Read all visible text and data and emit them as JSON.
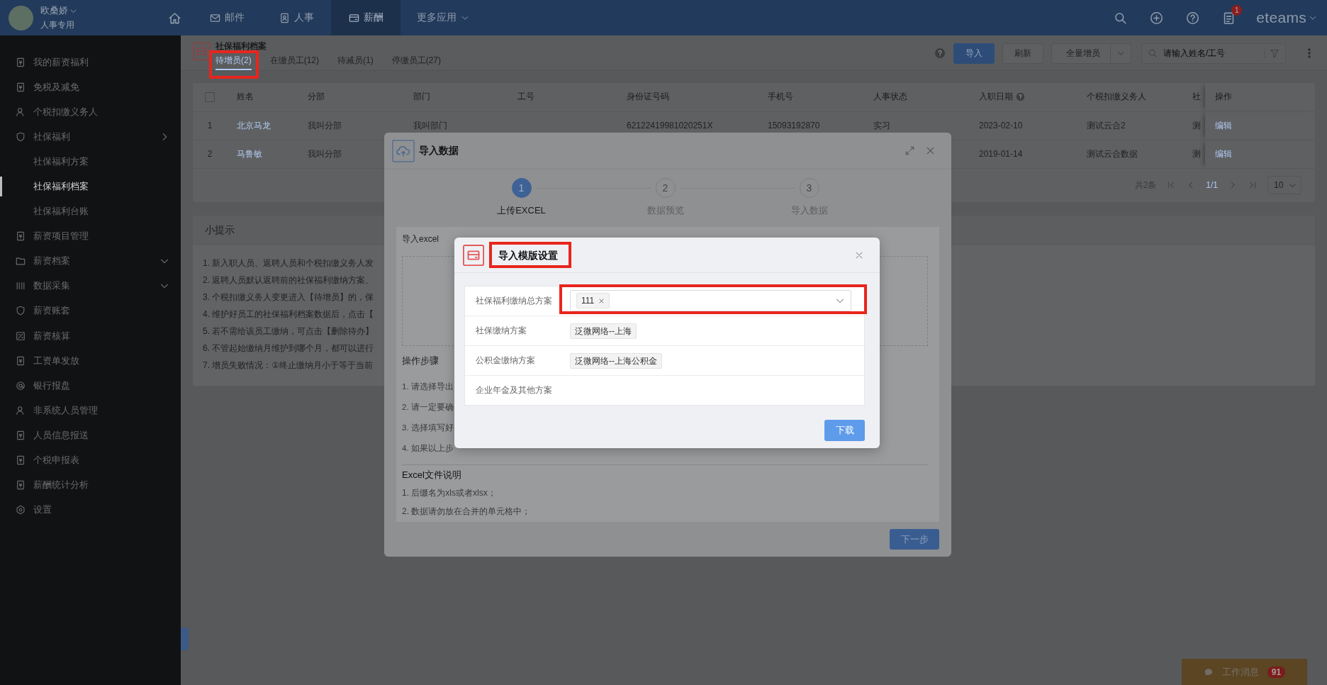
{
  "header": {
    "user": {
      "name": "欧桑娇",
      "role": "人事专用"
    },
    "nav": [
      {
        "label": "邮件",
        "kind": "link",
        "selected": false
      },
      {
        "label": "人事",
        "kind": "link",
        "selected": false
      },
      {
        "label": "薪酬",
        "kind": "link",
        "selected": true
      },
      {
        "label": "更多应用",
        "kind": "menu",
        "selected": false
      }
    ],
    "notification_count": "1",
    "logo": "eteams"
  },
  "sidebar": {
    "items": [
      {
        "label": "我的薪资福利",
        "selected": false
      },
      {
        "label": "免税及减免",
        "selected": false
      },
      {
        "label": "个税扣缴义务人",
        "selected": false
      },
      {
        "label": "社保福利",
        "selected": false,
        "expanded": true,
        "children": [
          {
            "label": "社保福利方案",
            "selected": false
          },
          {
            "label": "社保福利档案",
            "selected": true
          },
          {
            "label": "社保福利台账",
            "selected": false
          }
        ]
      },
      {
        "label": "薪资项目管理",
        "selected": false
      },
      {
        "label": "薪资档案",
        "selected": false,
        "expanded": false
      },
      {
        "label": "数据采集",
        "selected": false,
        "expanded": false
      },
      {
        "label": "薪资账套",
        "selected": false
      },
      {
        "label": "薪资核算",
        "selected": false
      },
      {
        "label": "工资单发放",
        "selected": false
      },
      {
        "label": "银行报盘",
        "selected": false
      },
      {
        "label": "非系统人员管理",
        "selected": false
      },
      {
        "label": "人员信息报送",
        "selected": false
      },
      {
        "label": "个税申报表",
        "selected": false
      },
      {
        "label": "薪酬统计分析",
        "selected": false
      },
      {
        "label": "设置",
        "selected": false
      }
    ]
  },
  "page": {
    "title": "社保福利档案",
    "tabs": [
      {
        "label": "待增员(2)",
        "selected": true,
        "highlighted": true
      },
      {
        "label": "在缴员工(12)",
        "selected": false,
        "highlighted": false
      },
      {
        "label": "待减员(1)",
        "selected": false,
        "highlighted": false
      },
      {
        "label": "停缴员工(27)",
        "selected": false,
        "highlighted": false
      }
    ],
    "toolbar": {
      "buttons": [
        {
          "label": "导入",
          "kind": "primary"
        },
        {
          "label": "刷新",
          "kind": "default"
        },
        {
          "label": "全量增员",
          "kind": "split"
        }
      ],
      "search": {
        "placeholder": "请输入姓名/工号"
      }
    },
    "table": {
      "select_all_checked": false,
      "columns": [
        {
          "label": "姓名",
          "help": false
        },
        {
          "label": "分部",
          "help": false
        },
        {
          "label": "部门",
          "help": false
        },
        {
          "label": "工号",
          "help": false
        },
        {
          "label": "身份证号码",
          "help": false
        },
        {
          "label": "手机号",
          "help": false
        },
        {
          "label": "人事状态",
          "help": false
        },
        {
          "label": "入职日期",
          "help": true
        },
        {
          "label": "个税扣缴义务人",
          "help": false
        },
        {
          "label": "社",
          "help": false
        },
        {
          "label": "操作",
          "help": false
        }
      ],
      "rows": [
        {
          "index": "1",
          "cells": [
            "北京马龙",
            "我叫分部",
            "我叫部门",
            null,
            "62122419981020251X",
            "15093192870",
            "实习",
            "2023-02-10",
            "测试云合2",
            "测",
            "编辑"
          ]
        },
        {
          "index": "2",
          "cells": [
            "马鲁敏",
            "我叫分部",
            null,
            null,
            null,
            null,
            null,
            "2019-01-14",
            "测试云合数据",
            "测",
            "编辑"
          ]
        }
      ]
    },
    "pagination": {
      "total": "共2条",
      "page": "1/1",
      "page_size": "10"
    }
  },
  "tips": {
    "title": "小提示",
    "lines": [
      "1. 新入职人员、返聘人员和个税扣缴义务人发",
      "2. 返聘人员默认返聘前的社保福利缴纳方案、",
      "3. 个税扣缴义务人变更进入【待增员】的，保",
      "4. 维护好员工的社保福利档案数据后，点击【",
      "5. 若不需给该员工缴纳，可点击【删除待办】",
      "6. 不管起始缴纳月维护到哪个月，都可以进行",
      "7. 增员失败情况：①终止缴纳月小于等于当前"
    ]
  },
  "import_dialog": {
    "title": "导入数据",
    "steps": [
      {
        "number": "1",
        "label": "上传EXCEL",
        "selected": true
      },
      {
        "number": "2",
        "label": "数据预览",
        "selected": false
      },
      {
        "number": "3",
        "label": "导入数据",
        "selected": false
      }
    ],
    "section_title": "导入excel",
    "steps_title": "操作步骤",
    "step_lines": [
      "1. 请选择导出",
      "2. 请一定要确",
      "3. 选择填写好",
      "4. 如果以上步"
    ],
    "file_title": "Excel文件说明",
    "file_lines": [
      "1. 后缀名为xls或者xlsx；",
      "2. 数据请勿放在合并的单元格中；"
    ],
    "next_button": "下一步"
  },
  "template_dialog": {
    "title": "导入模版设置",
    "title_highlighted": true,
    "rows": [
      {
        "label": "社保福利缴纳总方案",
        "kind": "select",
        "tags": [
          "111"
        ],
        "highlighted": true
      },
      {
        "label": "社保缴纳方案",
        "kind": "tags",
        "tags": [
          "泛微网络--上海"
        ],
        "highlighted": false
      },
      {
        "label": "公积金缴纳方案",
        "kind": "tags",
        "tags": [
          "泛微网络--上海公积金"
        ],
        "highlighted": false
      },
      {
        "label": "企业年金及其他方案",
        "kind": "tags",
        "highlighted": false
      }
    ],
    "download_button": "下载"
  },
  "work_message": {
    "label": "工作消息",
    "count": "91"
  }
}
